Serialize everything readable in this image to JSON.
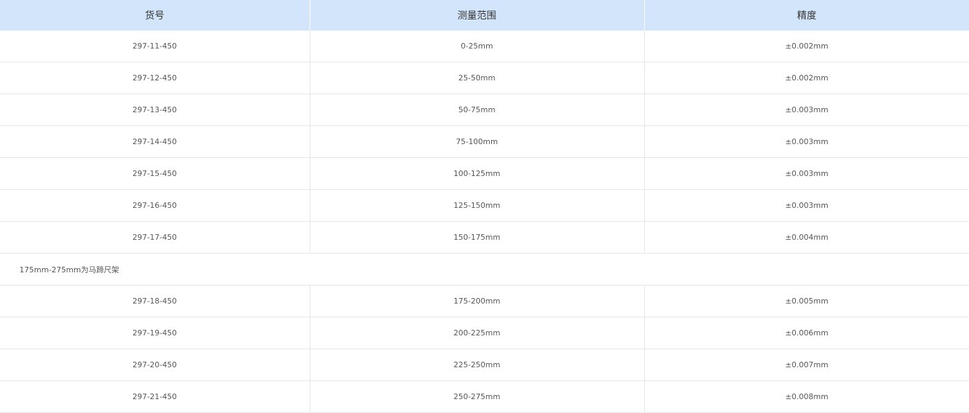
{
  "table": {
    "headers": [
      "货号",
      "测量范围",
      "精度"
    ],
    "rows_top": [
      [
        "297-11-450",
        "0-25mm",
        "±0.002mm"
      ],
      [
        "297-12-450",
        "25-50mm",
        "±0.002mm"
      ],
      [
        "297-13-450",
        "50-75mm",
        "±0.003mm"
      ],
      [
        "297-14-450",
        "75-100mm",
        "±0.003mm"
      ],
      [
        "297-15-450",
        "100-125mm",
        "±0.003mm"
      ],
      [
        "297-16-450",
        "125-150mm",
        "±0.003mm"
      ],
      [
        "297-17-450",
        "150-175mm",
        "±0.004mm"
      ]
    ],
    "note": "175mm-275mm为马蹄尺架",
    "rows_bottom": [
      [
        "297-18-450",
        "175-200mm",
        "±0.005mm"
      ],
      [
        "297-19-450",
        "200-225mm",
        "±0.006mm"
      ],
      [
        "297-20-450",
        "225-250mm",
        "±0.007mm"
      ],
      [
        "297-21-450",
        "250-275mm",
        "±0.008mm"
      ]
    ]
  }
}
